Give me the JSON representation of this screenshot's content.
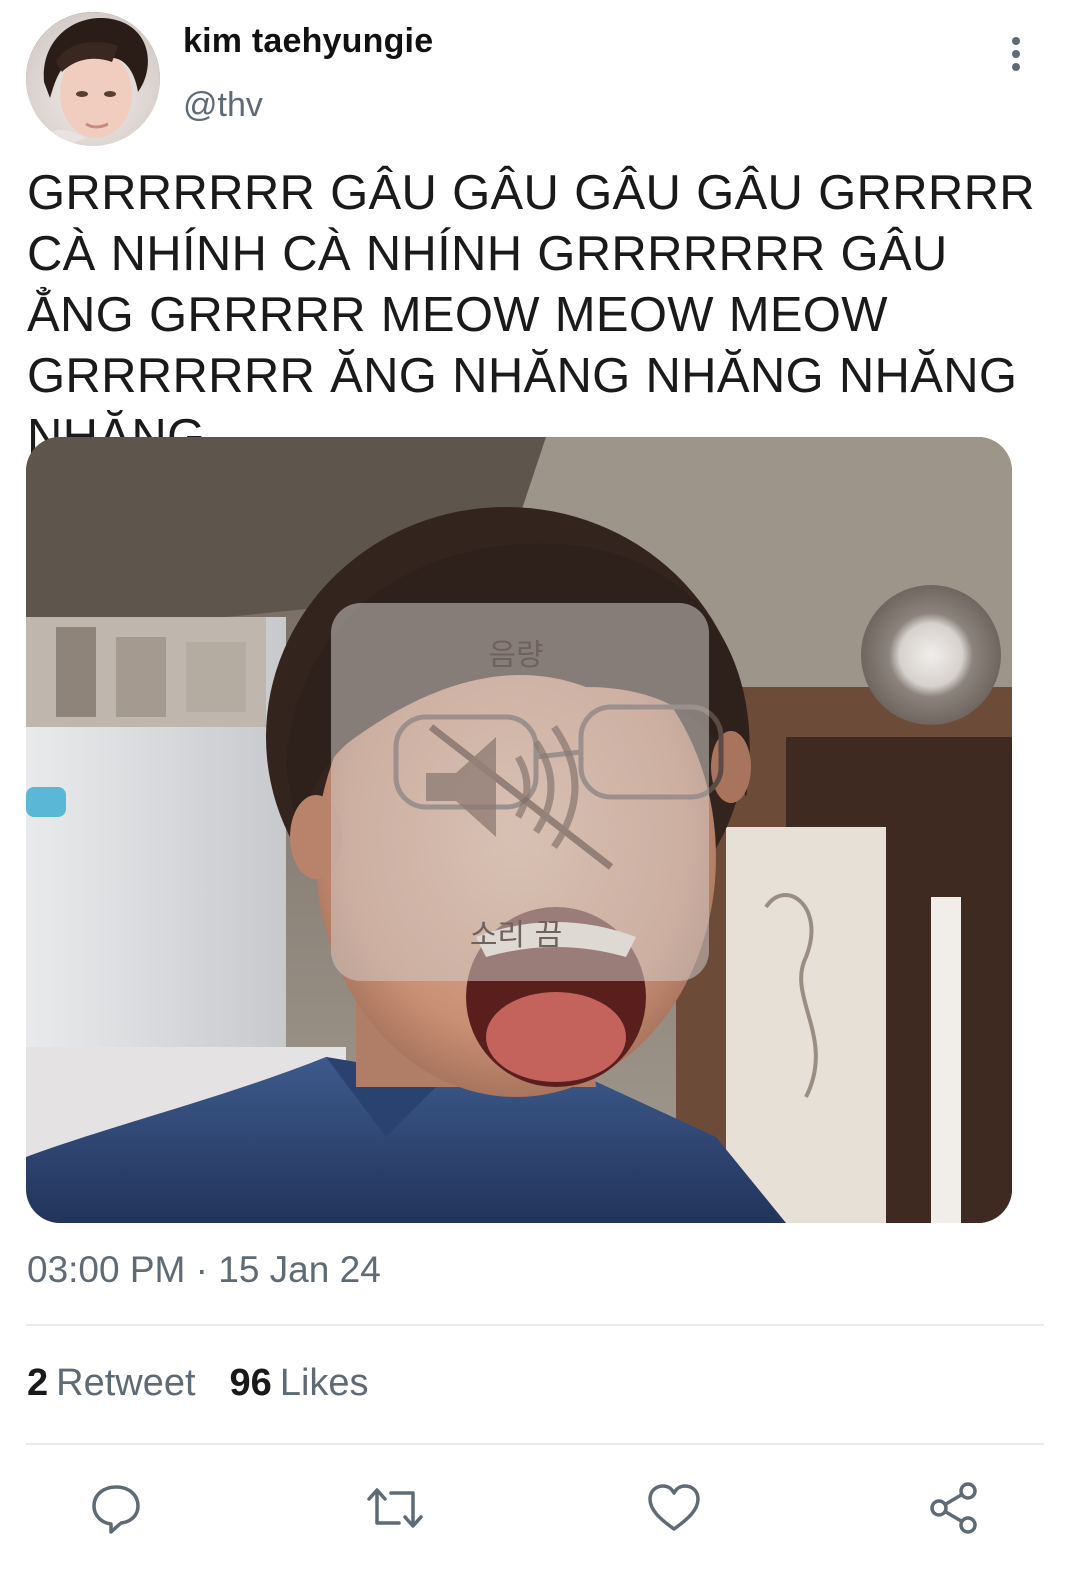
{
  "user": {
    "display_name": "kim taehyungie",
    "handle": "@thv"
  },
  "tweet": {
    "text": "GRRRRRRR GÂU GÂU GÂU GÂU GRRRRR CÀ NHÍNH CÀ NHÍNH GRRRRRRR GÂU ẲNG GRRRRR MEOW MEOW MEOW GRRRRRRR ĂNG NHĂNG NHĂNG NHĂNG NHĂNG",
    "timestamp": "03:00 PM · 15 Jan 24"
  },
  "media": {
    "overlay_top_label": "음량",
    "overlay_bottom_label": "소리 끔"
  },
  "stats": {
    "retweet_count": "2",
    "retweet_label": "Retweet",
    "likes_count": "96",
    "likes_label": "Likes"
  },
  "icons": {
    "more": "more-vertical-icon",
    "reply": "reply-icon",
    "retweet": "retweet-icon",
    "like": "heart-icon",
    "share": "share-icon"
  },
  "colors": {
    "secondary_text": "#5e6b76",
    "divider": "#e6ecf0",
    "icon": "#5e6b76"
  }
}
